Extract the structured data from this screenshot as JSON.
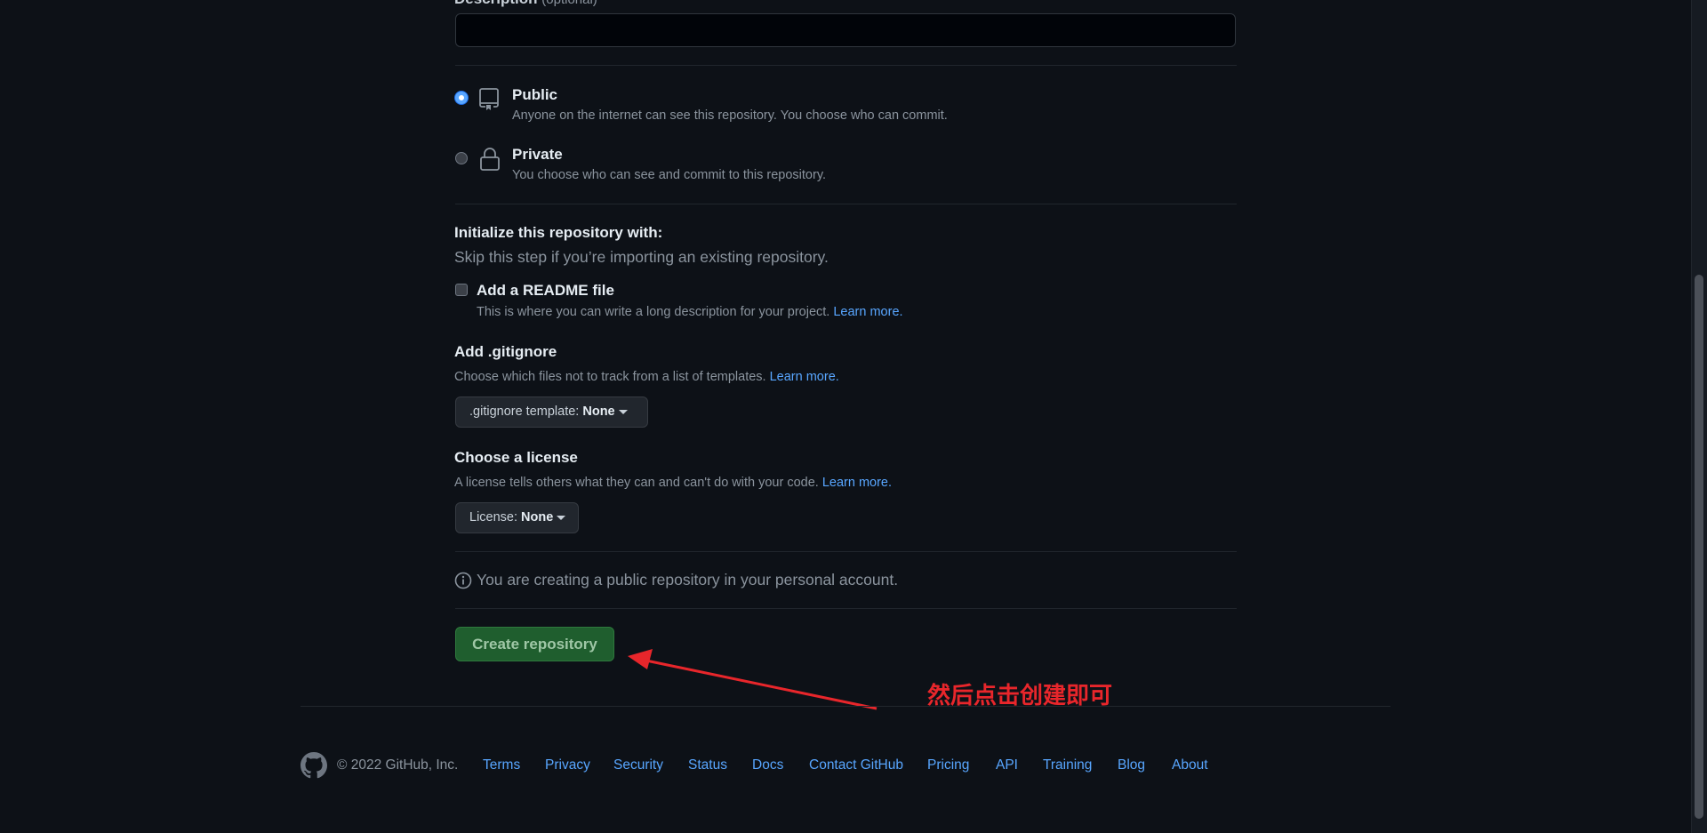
{
  "description": {
    "label": "Description",
    "optional": "(optional)",
    "value": ""
  },
  "visibility": {
    "public": {
      "title": "Public",
      "desc": "Anyone on the internet can see this repository. You choose who can commit.",
      "checked": true
    },
    "private": {
      "title": "Private",
      "desc": "You choose who can see and commit to this repository.",
      "checked": false
    }
  },
  "init": {
    "title": "Initialize this repository with:",
    "subtitle": "Skip this step if you’re importing an existing repository.",
    "readme_label": "Add a README file",
    "readme_desc": "This is where you can write a long description for your project.",
    "learn_more": "Learn more."
  },
  "gitignore": {
    "title": "Add .gitignore",
    "desc": "Choose which files not to track from a list of templates.",
    "learn_more": "Learn more.",
    "button_prefix": ".gitignore template:",
    "button_value": "None"
  },
  "license": {
    "title": "Choose a license",
    "desc": "A license tells others what they can and can't do with your code.",
    "learn_more": "Learn more.",
    "button_prefix": "License:",
    "button_value": "None"
  },
  "info": {
    "text": "You are creating a public repository in your personal account."
  },
  "create_button": "Create repository",
  "annotation": {
    "text": "然后点击创建即可",
    "color": "#e8262b"
  },
  "footer": {
    "copyright": "© 2022 GitHub, Inc.",
    "links": [
      "Terms",
      "Privacy",
      "Security",
      "Status",
      "Docs",
      "Contact GitHub",
      "Pricing",
      "API",
      "Training",
      "Blog",
      "About"
    ]
  },
  "colors": {
    "background": "#0d1117",
    "link": "#58a6ff",
    "create_button": "#1f5e2e"
  }
}
